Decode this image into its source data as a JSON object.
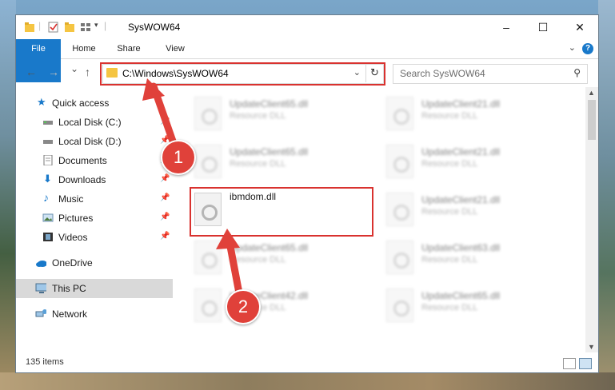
{
  "window": {
    "title": "SysWOW64",
    "controls": {
      "minimize": "–",
      "maximize": "☐",
      "close": "✕"
    }
  },
  "ribbon": {
    "tabs": [
      "File",
      "Home",
      "Share",
      "View"
    ],
    "help": "?"
  },
  "nav": {
    "back": "←",
    "forward": "→",
    "recent": "⌄",
    "up": "↑",
    "address": "C:\\Windows\\SysWOW64",
    "search_placeholder": "Search SysWOW64"
  },
  "sidebar": {
    "items": [
      {
        "label": "Quick access",
        "icon": "star-icon"
      },
      {
        "label": "Local Disk (C:)",
        "icon": "drive-icon"
      },
      {
        "label": "Local Disk (D:)",
        "icon": "drive-icon"
      },
      {
        "label": "Documents",
        "icon": "documents-icon"
      },
      {
        "label": "Downloads",
        "icon": "download-icon"
      },
      {
        "label": "Music",
        "icon": "music-icon"
      },
      {
        "label": "Pictures",
        "icon": "pictures-icon"
      },
      {
        "label": "Videos",
        "icon": "videos-icon"
      },
      {
        "label": "OneDrive",
        "icon": "cloud-icon"
      },
      {
        "label": "This PC",
        "icon": "computer-icon"
      },
      {
        "label": "Network",
        "icon": "network-icon"
      }
    ]
  },
  "files": {
    "highlighted": {
      "name": "ibmdom.dll"
    },
    "others": [
      {
        "name": "UpdateClient65.dll",
        "type": "Resource DLL"
      },
      {
        "name": "UpdateClient21.dll",
        "type": "Resource DLL"
      },
      {
        "name": "UpdateClient65.dll",
        "type": "Resource DLL"
      },
      {
        "name": "UpdateClient21.dll",
        "type": "Resource DLL"
      },
      {
        "name": "UpdateClient21.dll",
        "type": "Resource DLL"
      },
      {
        "name": "UpdateClient65.dll",
        "type": "Resource DLL"
      },
      {
        "name": "UpdateClient63.dll",
        "type": "Resource DLL"
      },
      {
        "name": "UpdateClient42.dll",
        "type": "Resource DLL"
      },
      {
        "name": "UpdateClient65.dll",
        "type": "Resource DLL"
      }
    ]
  },
  "status": {
    "count": "135 items"
  },
  "callouts": [
    "1",
    "2"
  ],
  "colors": {
    "accent": "#1979ca",
    "highlight": "#d9322f",
    "selected": "#d9d9d9"
  }
}
